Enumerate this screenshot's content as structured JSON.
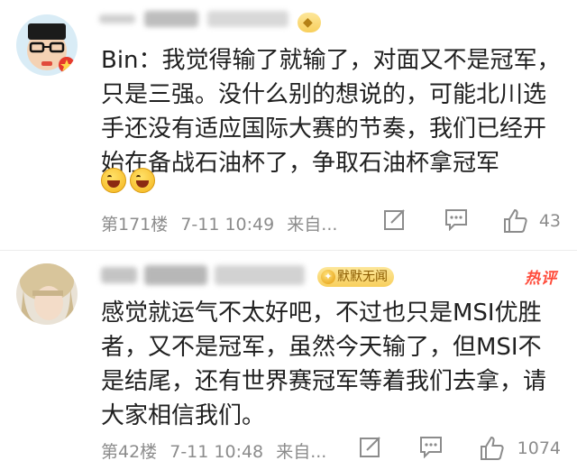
{
  "comments": [
    {
      "text": "Bin：我觉得输了就输了，对面又不是冠军，只是三强。没什么别的想说的，可能北川选手还没有适应国际大赛的节奏，我们已经开始在备战石油杯了，争取石油杯拿冠军",
      "emoji_count": 2,
      "emoji": "laughing-emoji",
      "floor": "第171楼",
      "date": "7-11 10:49",
      "source": "来自...",
      "likes": "43",
      "hot": "",
      "badge": "",
      "avatar": "cartoon-avatar"
    },
    {
      "text": "感觉就运气不太好吧，不过也只是MSI优胜者，又不是冠军，虽然今天输了，但MSI不是结尾，还有世界赛冠军等着我们去拿，请大家相信我们。",
      "emoji_count": 0,
      "floor": "第42楼",
      "date": "7-11 10:48",
      "source": "来自...",
      "likes": "1074",
      "hot": "热评",
      "badge": "默默无闻",
      "avatar": "photo-avatar"
    }
  ],
  "colors": {
    "hot": "#ff4b3a",
    "meta": "#8c8c8c",
    "badge": "#f8cf5c"
  },
  "icons": [
    "edit-icon",
    "comment-icon",
    "like-icon"
  ]
}
